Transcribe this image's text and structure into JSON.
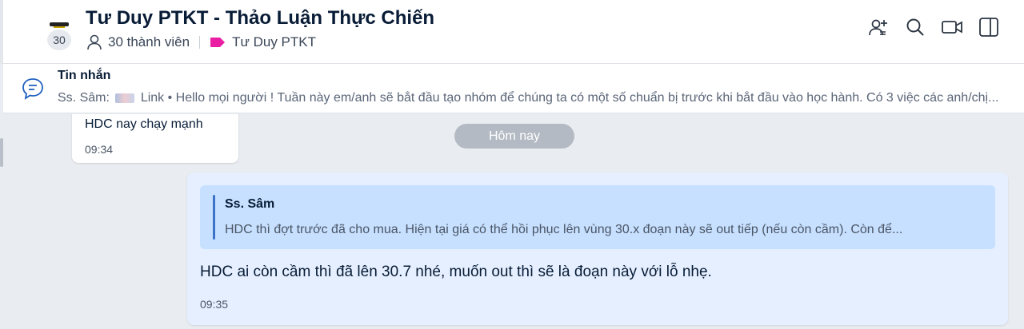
{
  "header": {
    "avatar_count": "30",
    "title": "Tư Duy PTKT - Thảo Luận Thực Chiến",
    "members_label": "30 thành viên",
    "tag_label": "Tư Duy PTKT",
    "tag_color": "#e91ea3",
    "actions": [
      "add-member-icon",
      "search-icon",
      "video-call-icon",
      "sidebar-toggle-icon"
    ]
  },
  "pinned": {
    "title": "Tin nhắn",
    "sender": "Ss. Sâm:",
    "text": "Link • Hello mọi người ! Tuần này em/anh sẽ bắt đầu tạo nhóm để chúng ta có một số chuẩn bị trước khi bắt đầu vào học hành. Có 3 việc các anh/chị..."
  },
  "chat": {
    "prev_message": {
      "text": "HDC nay chạy mạnh",
      "time": "09:34"
    },
    "date_divider": "Hôm nay",
    "message": {
      "quote_author": "Ss. Sâm",
      "quote_text": "HDC thì đợt trước đã cho mua. Hiện tại giá có thể hồi phục lên vùng 30.x đoạn này sẽ out tiếp (nếu còn cầm). Còn để...",
      "text": "HDC ai còn cầm thì đã lên 30.7 nhé, muốn out thì sẽ là đoạn này với lỗ nhẹ.",
      "time": "09:35"
    }
  },
  "colors": {
    "accent": "#3c73c7",
    "bubble_self": "#e5efff",
    "quote_bg": "#c7e0ff",
    "chat_bg": "#e9ecf0"
  }
}
